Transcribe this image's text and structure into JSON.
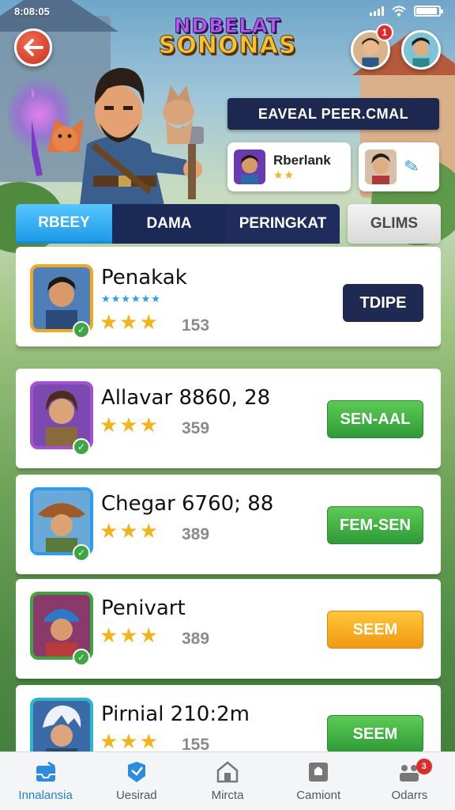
{
  "status_bar": {
    "time": "8:08:05"
  },
  "header": {
    "logo_line1": "NDBELAT",
    "logo_line2": "SONONAS",
    "notification_count": "1"
  },
  "panel": {
    "title": "EAVEAL PEER.CMAL",
    "friend_card": {
      "name": "Rberlank",
      "stars": "★★"
    }
  },
  "tabs": [
    {
      "label": "RBEEY"
    },
    {
      "label": "DAMA"
    },
    {
      "label": "PERINGKAT"
    },
    {
      "label": "GLIMS"
    }
  ],
  "players": [
    {
      "name": "Penakak",
      "score": "153",
      "action": "TDIPE",
      "stars": "★★★",
      "subrating": "★★★★★★"
    },
    {
      "name": "Allavar 8860, 28",
      "score": "359",
      "action": "SEN-AAL",
      "stars": "★★★"
    },
    {
      "name": "Chegar 6760; 88",
      "score": "389",
      "action": "FEM-SEN",
      "stars": "★★★"
    },
    {
      "name": "Penivart",
      "score": "389",
      "action": "SEEM",
      "stars": "★★★"
    },
    {
      "name": "Pirnial 210:2m",
      "score": "155",
      "action": "SEEM",
      "stars": "★★★"
    }
  ],
  "bottom_nav": {
    "items": [
      {
        "label": "Innalansia",
        "icon": "inbox-icon"
      },
      {
        "label": "Uesirad",
        "icon": "shield-icon"
      },
      {
        "label": "Mircta",
        "icon": "house-icon"
      },
      {
        "label": "Camiont",
        "icon": "box-icon"
      },
      {
        "label": "Odarrs",
        "icon": "people-icon"
      }
    ],
    "badge_count": "3"
  },
  "colors": {
    "accent_blue": "#1f9ae8",
    "navy": "#1e2a52",
    "green_button": "#3ca642",
    "orange_button": "#f09a12",
    "star_gold": "#f2b418"
  }
}
